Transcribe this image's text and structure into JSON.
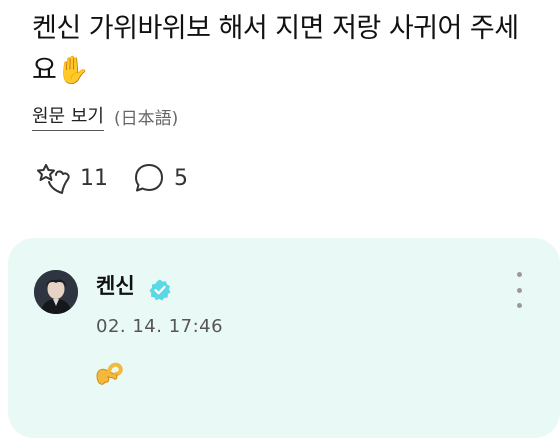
{
  "post": {
    "text": "켄신 가위바위보 해서 지면 저랑 사귀어 주세요✋",
    "view_original_label": "원문 보기",
    "original_language": "(日本語)"
  },
  "reactions": {
    "like_icon": "sparkle-heart-icon",
    "like_count": "11",
    "comment_icon": "speech-bubble-icon",
    "comment_count": "5"
  },
  "comment": {
    "author": "켄신",
    "verified_icon": "verified-badge-icon",
    "timestamp": "02. 14. 17:46",
    "body_emoji": "👌",
    "background_color": "#e9faf6",
    "verified_color": "#5ad8e6"
  }
}
